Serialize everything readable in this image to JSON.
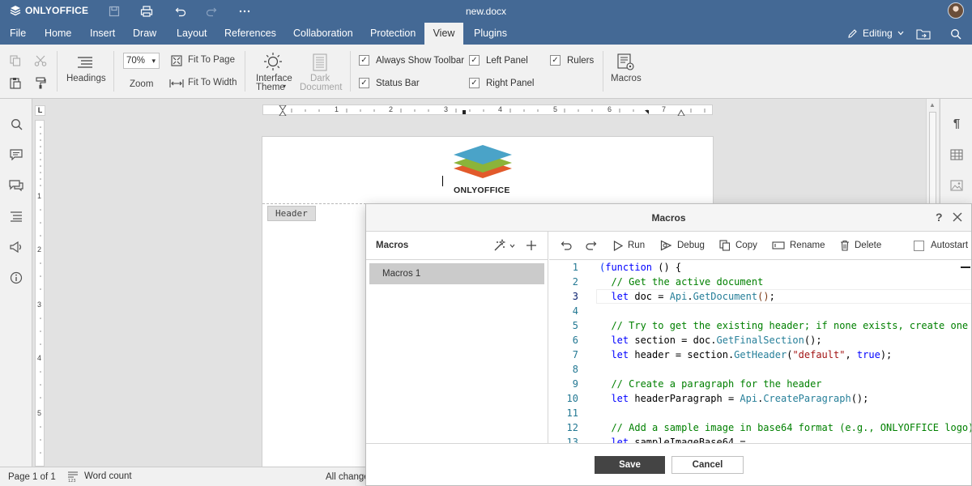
{
  "titlebar": {
    "brand": "ONLYOFFICE",
    "doc_title": "new.docx"
  },
  "tabs": [
    {
      "label": "File"
    },
    {
      "label": "Home"
    },
    {
      "label": "Insert"
    },
    {
      "label": "Draw"
    },
    {
      "label": "Layout"
    },
    {
      "label": "References"
    },
    {
      "label": "Collaboration"
    },
    {
      "label": "Protection"
    },
    {
      "label": "View"
    },
    {
      "label": "Plugins"
    }
  ],
  "active_tab": "View",
  "editing_mode": "Editing",
  "ribbon": {
    "headings": "Headings",
    "zoom_value": "70%",
    "zoom": "Zoom",
    "fit_to_page": "Fit To Page",
    "fit_to_width": "Fit To Width",
    "interface_theme_1": "Interface",
    "interface_theme_2": "Theme",
    "dark_document_1": "Dark",
    "dark_document_2": "Document",
    "always_show_toolbar": "Always Show Toolbar",
    "status_bar": "Status Bar",
    "left_panel": "Left Panel",
    "right_panel": "Right Panel",
    "rulers": "Rulers",
    "macros": "Macros"
  },
  "ruler_numbers": [
    "1",
    "2",
    "3",
    "4",
    "5",
    "6",
    "7"
  ],
  "vruler_numbers": [
    "1",
    "2",
    "3",
    "4",
    "5"
  ],
  "document": {
    "logo_text": "ONLYOFFICE",
    "header_tag": "Header"
  },
  "statusbar": {
    "page": "Page 1 of 1",
    "word_count": "Word count",
    "changes": "All change"
  },
  "dialog": {
    "title": "Macros",
    "help": "?",
    "list_title": "Macros",
    "macros": [
      {
        "name": "Macros 1"
      }
    ],
    "toolbar": {
      "run": "Run",
      "debug": "Debug",
      "copy": "Copy",
      "rename": "Rename",
      "delete": "Delete",
      "autostart": "Autostart"
    },
    "line_numbers": [
      "1",
      "2",
      "3",
      "4",
      "5",
      "6",
      "7",
      "8",
      "9",
      "10",
      "11",
      "12",
      "13"
    ],
    "code": {
      "l1a": "(",
      "l1b": "function",
      "l1c": " () {",
      "l2": "  // Get the active document",
      "l3a": "  let",
      "l3b": " doc = ",
      "l3c": "Api",
      "l3d": ".",
      "l3e": "GetDocument",
      "l3f": "()",
      "l3g": ";",
      "l5": "  // Try to get the existing header; if none exists, create one",
      "l6a": "  let",
      "l6b": " section = doc.",
      "l6c": "GetFinalSection",
      "l6d": "();",
      "l7a": "  let",
      "l7b": " header = section.",
      "l7c": "GetHeader",
      "l7d": "(",
      "l7e": "\"default\"",
      "l7f": ", ",
      "l7g": "true",
      "l7h": ");",
      "l9": "  // Create a paragraph for the header",
      "l10a": "  let",
      "l10b": " headerParagraph = ",
      "l10c": "Api",
      "l10d": ".",
      "l10e": "CreateParagraph",
      "l10f": "();",
      "l12": "  // Add a sample image in base64 format (e.g., ONLYOFFICE logo)",
      "l13a": "  let",
      "l13b": " sampleImageBase64 = "
    },
    "save": "Save",
    "cancel": "Cancel"
  },
  "colors": {
    "brand_blue": "#446995",
    "logo_blue": "#4aa3c8",
    "logo_green": "#8bb43a",
    "logo_orange": "#e25a2b"
  }
}
